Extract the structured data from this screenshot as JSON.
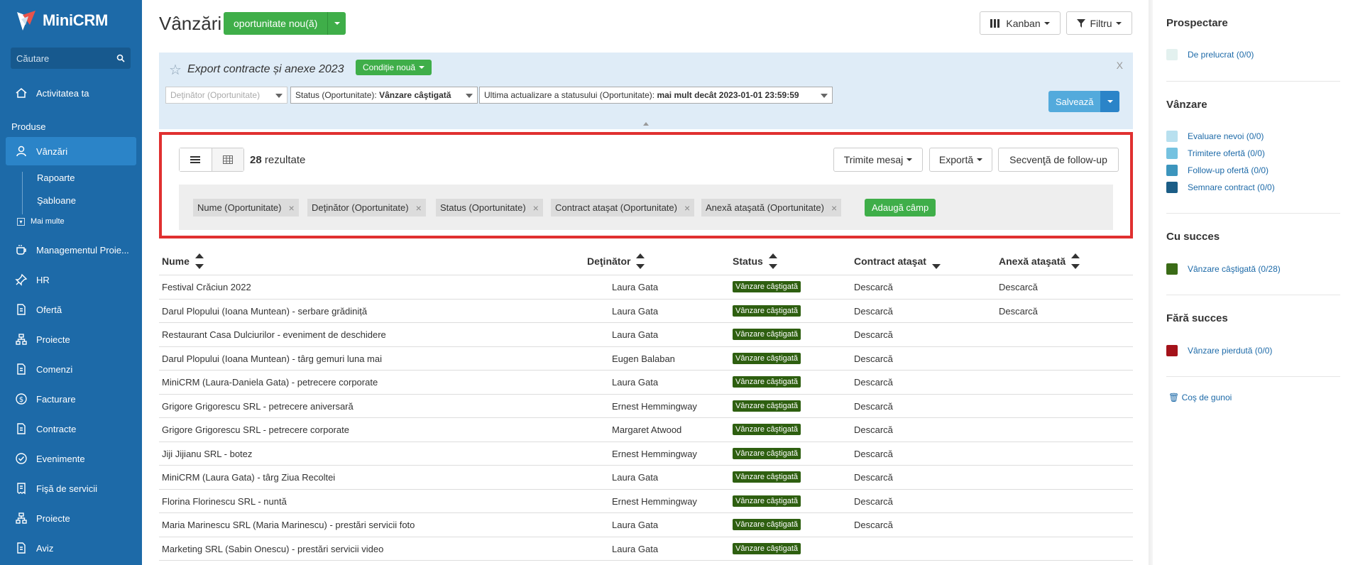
{
  "sidebar": {
    "brand": "MiniCRM",
    "search_placeholder": "Căutare",
    "nav": [
      {
        "label": "Activitatea ta"
      },
      {
        "label": "Vânzări"
      },
      {
        "label": "Managementul Proie..."
      },
      {
        "label": "HR"
      },
      {
        "label": "Ofertă"
      },
      {
        "label": "Proiecte"
      },
      {
        "label": "Comenzi"
      },
      {
        "label": "Facturare"
      },
      {
        "label": "Contracte"
      },
      {
        "label": "Evenimente"
      },
      {
        "label": "Fişă de servicii"
      },
      {
        "label": "Proiecte"
      },
      {
        "label": "Aviz"
      }
    ],
    "section_produse": "Produse",
    "sub": [
      {
        "label": "Rapoarte"
      },
      {
        "label": "Şabloane"
      }
    ],
    "more": "Mai multe"
  },
  "header": {
    "title": "Vânzări",
    "new_opportunity": "oportunitate nou(ă)",
    "kanban": "Kanban",
    "filter": "Filtru"
  },
  "filter_panel": {
    "name": "Export contracte și anexe 2023",
    "condition_button": "Condiție nouă",
    "close": "X",
    "selects": [
      {
        "label": "Deţinător (Oportunitate)",
        "value": ""
      },
      {
        "label": "Status (Oportunitate): ",
        "value": "Vânzare câştigată"
      },
      {
        "label": "Ultima actualizare a statusului (Oportunitate): ",
        "value": "mai mult decât 2023-01-01 23:59:59"
      }
    ],
    "save": "Salvează"
  },
  "results": {
    "count": "28",
    "count_label": " rezultate",
    "send_message": "Trimite mesaj",
    "export": "Exportă",
    "followup": "Secvenţă de follow-up",
    "fields": [
      "Nume (Oportunitate)",
      "Deţinător (Oportunitate)",
      "Status (Oportunitate)",
      "Contract ataşat (Oportunitate)",
      "Anexă ataşată (Oportunitate)"
    ],
    "add_field": "Adaugă câmp"
  },
  "table": {
    "columns": [
      "Nume",
      "Deţinător",
      "Status",
      "Contract ataşat",
      "Anexă ataşată"
    ],
    "rows": [
      [
        "Festival Crăciun 2022",
        "Laura Gata",
        "Vânzare câştigată",
        "Descarcă",
        "Descarcă"
      ],
      [
        "Darul Plopului (Ioana Muntean) - serbare grădiniță",
        "Laura Gata",
        "Vânzare câştigată",
        "Descarcă",
        "Descarcă"
      ],
      [
        "Restaurant Casa Dulciurilor - eveniment de deschidere",
        "Laura Gata",
        "Vânzare câştigată",
        "Descarcă",
        ""
      ],
      [
        "Darul Plopului (Ioana Muntean) - târg gemuri luna mai",
        "Eugen Balaban",
        "Vânzare câştigată",
        "Descarcă",
        ""
      ],
      [
        "MiniCRM (Laura-Daniela Gata) - petrecere corporate",
        "Laura Gata",
        "Vânzare câştigată",
        "Descarcă",
        ""
      ],
      [
        "Grigore Grigorescu SRL - petrecere aniversară",
        "Ernest Hemmingway",
        "Vânzare câştigată",
        "Descarcă",
        ""
      ],
      [
        "Grigore Grigorescu SRL - petrecere corporate",
        "Margaret Atwood",
        "Vânzare câştigată",
        "Descarcă",
        ""
      ],
      [
        "Jiji Jijianu SRL - botez",
        "Ernest Hemmingway",
        "Vânzare câştigată",
        "Descarcă",
        ""
      ],
      [
        "MiniCRM (Laura Gata) - târg Ziua Recoltei",
        "Laura Gata",
        "Vânzare câştigată",
        "Descarcă",
        ""
      ],
      [
        "Florina Florinescu SRL - nuntă",
        "Ernest Hemmingway",
        "Vânzare câştigată",
        "Descarcă",
        ""
      ],
      [
        "Maria Marinescu SRL (Maria Marinescu) - prestări servicii foto",
        "Laura Gata",
        "Vânzare câştigată",
        "Descarcă",
        ""
      ],
      [
        "Marketing SRL (Sabin Onescu) - prestări servicii video",
        "Laura Gata",
        "Vânzare câştigată",
        "",
        ""
      ]
    ]
  },
  "right_panel": {
    "groups": [
      {
        "title": "Prospectare",
        "items": [
          {
            "label": "De prelucrat (0/0)",
            "color": "#e3f1ef"
          }
        ]
      },
      {
        "title": "Vânzare",
        "items": [
          {
            "label": "Evaluare nevoi (0/0)",
            "color": "#b8e0ef"
          },
          {
            "label": "Trimitere ofertă (0/0)",
            "color": "#75c2e0"
          },
          {
            "label": "Follow-up ofertă (0/0)",
            "color": "#3c95bd"
          },
          {
            "label": "Semnare contract (0/0)",
            "color": "#1b5d86"
          }
        ]
      },
      {
        "title": "Cu succes",
        "items": [
          {
            "label": "Vânzare câştigată (0/28)",
            "color": "#3a6b16"
          }
        ]
      },
      {
        "title": "Fără succes",
        "items": [
          {
            "label": "Vânzare pierdută (0/0)",
            "color": "#a4121a"
          }
        ]
      }
    ],
    "trash": "Coş de gunoi"
  },
  "colors": {
    "sidebar": "#1d6aa8",
    "sidebar_active": "#2b84c8",
    "green": "#3fae49",
    "badge": "#2e5f10",
    "highlight_border": "#e03030",
    "filter_panel": "#dfecf7",
    "link": "#1d6aa8"
  }
}
